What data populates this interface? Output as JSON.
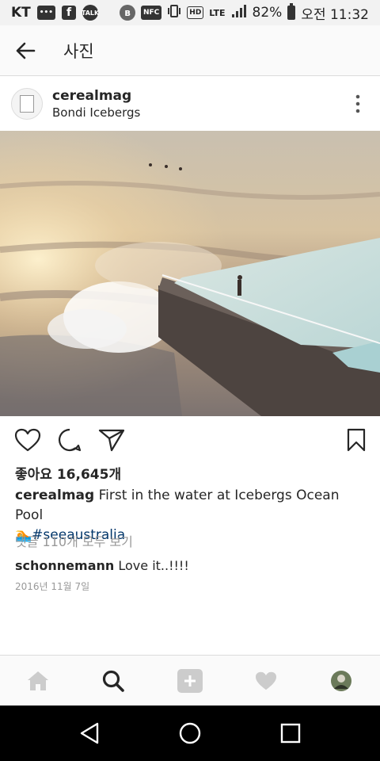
{
  "status_bar": {
    "carrier": "KT",
    "icons": [
      "chat-icon",
      "facebook-icon",
      "kakaotalk-icon",
      "bluetooth-icon",
      "nfc-icon",
      "vibrate-icon",
      "hd-icon",
      "lte-icon",
      "signal-icon",
      "battery-icon"
    ],
    "talk_label": "TALK",
    "nfc_label": "NFC",
    "hd_label": "HD",
    "lte_label": "LTE",
    "battery": "82%",
    "time": "오전 11:32"
  },
  "header": {
    "title": "사진"
  },
  "post": {
    "username": "cerealmag",
    "location": "Bondi Icebergs",
    "likes": "좋아요 16,645개",
    "caption_username": "cerealmag",
    "caption_text": " First in the water at Icebergs Ocean Pool",
    "caption_emoji": "🏊",
    "caption_hashtag": "#seeaustralia",
    "view_comments": "댓글 110개 모두 보기",
    "comment_username": "schonnemann",
    "comment_text": " Love it..!!!!",
    "date": "2016년 11월 7일"
  },
  "colors": {
    "link": "#003569",
    "muted": "#999999",
    "border": "#dbdbdb",
    "icon_inactive": "#cccccc"
  }
}
